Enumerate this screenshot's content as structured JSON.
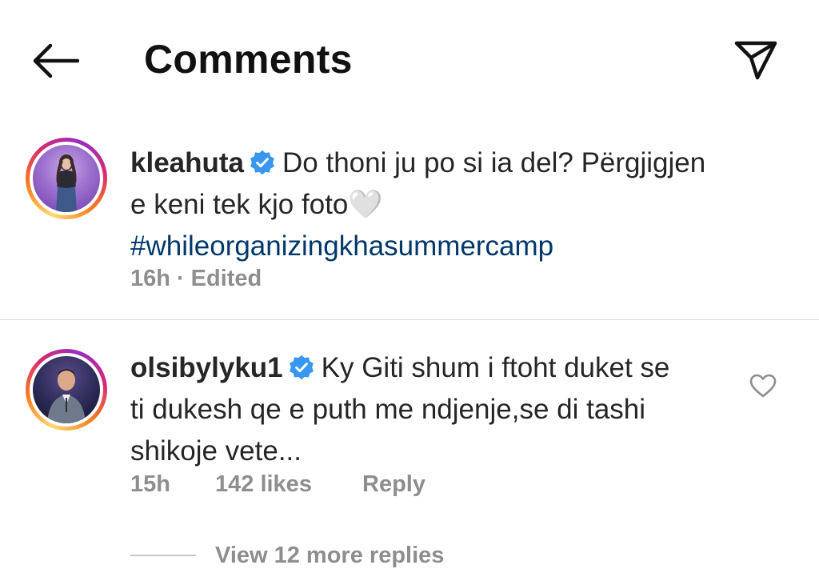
{
  "header": {
    "title": "Comments",
    "back_icon": "arrow-left-icon",
    "share_icon": "paper-plane-icon"
  },
  "caption": {
    "username": "kleahuta",
    "verified": true,
    "text_line1": "Do thoni ju po si ia del? Përgjigjen",
    "text_line2": "e keni tek kjo foto🤍",
    "hashtag": "#whileorganizingkhasummercamp",
    "time": "16h",
    "separator": "·",
    "edited": "Edited"
  },
  "comment": {
    "username": "olsibylyku1",
    "verified": true,
    "text_line1": "Ky Giti shum i ftoht duket se",
    "text_line2": "ti dukesh qe e puth me ndjenje,se di tashi",
    "text_line3": "shikoje vete...",
    "time": "15h",
    "likes": "142 likes",
    "reply_label": "Reply",
    "like_icon": "heart-outline-icon",
    "view_replies": "View 12 more replies"
  },
  "colors": {
    "text": "#262626",
    "secondary": "#8e8e8e",
    "hashtag": "#00376b",
    "verified": "#3897f0",
    "divider": "#dbdbdb"
  }
}
